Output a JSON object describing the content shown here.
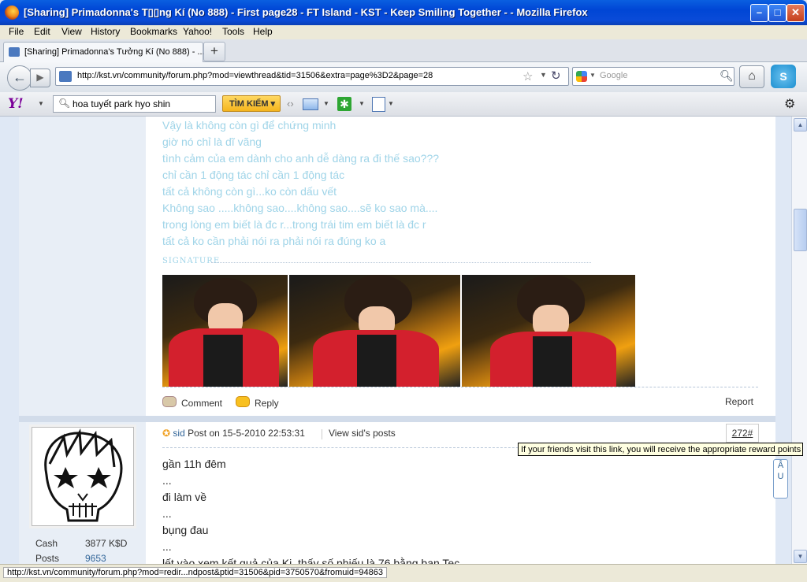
{
  "window": {
    "title": "[Sharing] Primadonna's T▯▯ng Kí (No 888) - First page28 - FT Island - KST - Keep Smiling Together - - Mozilla Firefox",
    "buttons": {
      "minimize": "–",
      "maximize": "□",
      "close": "✕"
    }
  },
  "menu": [
    "File",
    "Edit",
    "View",
    "History",
    "Bookmarks",
    "Yahoo!",
    "Tools",
    "Help"
  ],
  "tab": {
    "label": "[Sharing] Primadonna's Tưởng Kí (No 888) - ...",
    "new_tab": "+"
  },
  "nav": {
    "url": "http://kst.vn/community/forum.php?mod=viewthread&tid=31506&extra=page%3D2&page=28",
    "search_placeholder": "Google"
  },
  "yahoo_toolbar": {
    "logo": "Y!",
    "search_value": "hoa tuyết park hyo shin",
    "search_button": "TÌM KIẾM ▾"
  },
  "post1": {
    "lines": [
      "Vậy là không còn gì để chứng minh",
      "giờ nó chỉ là dĩ vãng",
      "tình cảm của em dành cho anh dễ dàng ra đi thế sao???",
      "chỉ cần 1 động tác  chỉ cần 1 động tác",
      "tất cả không còn gì...ko còn dấu vết",
      "Không sao .....không sao....không sao....sẽ ko sao mà....",
      "trong lòng em biết là đc r...trong trái tim em biết là đc r",
      "tất cả ko cần phải nói ra phải nói ra đúng ko a"
    ],
    "signature_label": "SIGNATURE",
    "actions": {
      "comment": "Comment",
      "reply": "Reply",
      "report": "Report"
    }
  },
  "post2": {
    "author": "sid",
    "posted_prefix": "Post on 15-5-2010 22:53:31",
    "view_posts": "View sid's posts",
    "post_number": "272#",
    "stats": [
      {
        "label": "Cash",
        "value": "3877 K$D"
      },
      {
        "label": "Posts",
        "value": "9653"
      }
    ],
    "lines": [
      "gần 11h đêm",
      "...",
      "đi làm về",
      "...",
      "bụng đau",
      "...",
      "lết vào xem kết quả của Ki, thấy số phiếu là 76 bằng bạn Tec"
    ]
  },
  "tooltip": "If your friends visit this link, you will receive the appropriate reward points",
  "side_tab": "Â\nU",
  "status": "http://kst.vn/community/forum.php?mod=redir...ndpost&ptid=31506&pid=3750570&fromuid=94863"
}
